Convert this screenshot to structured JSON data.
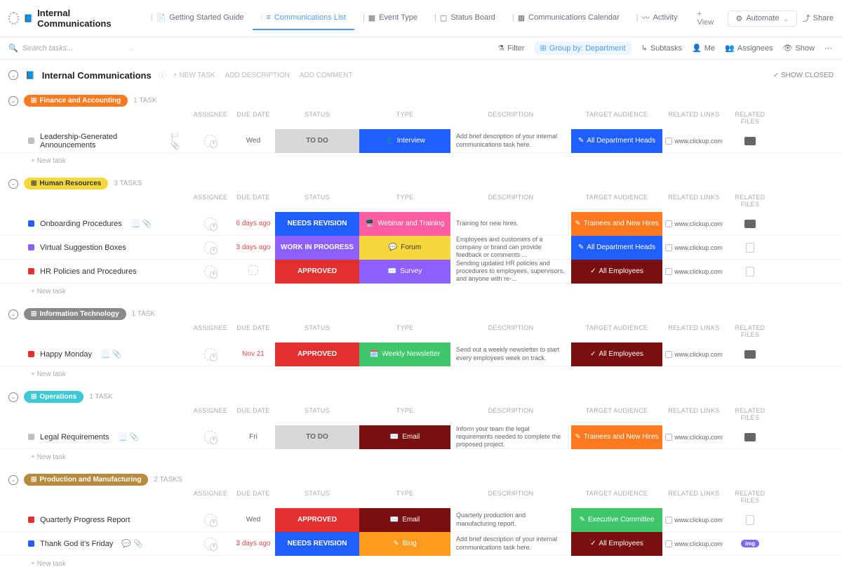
{
  "workspace": {
    "title": "Internal Communications"
  },
  "views": [
    {
      "label": "Getting Started Guide",
      "icon": "📄"
    },
    {
      "label": "Communications List",
      "icon": "≡",
      "active": true
    },
    {
      "label": "Event Type",
      "icon": "▦"
    },
    {
      "label": "Status Board",
      "icon": "▢"
    },
    {
      "label": "Communications Calendar",
      "icon": "▦"
    },
    {
      "label": "Activity",
      "icon": "〰"
    }
  ],
  "addView": "+ View",
  "topRight": {
    "automate": "Automate",
    "share": "Share"
  },
  "filterBar": {
    "searchPlaceholder": "Search tasks...",
    "filter": "Filter",
    "groupBy": "Group by: Department",
    "subtasks": "Subtasks",
    "me": "Me",
    "assignees": "Assignees",
    "show": "Show"
  },
  "listHeader": {
    "title": "Internal Communications",
    "newTask": "+ NEW TASK",
    "addDesc": "ADD DESCRIPTION",
    "addComment": "ADD COMMENT",
    "showClosed": "SHOW CLOSED"
  },
  "columns": {
    "assignee": "ASSIGNEE",
    "due": "DUE DATE",
    "status": "STATUS",
    "type": "TYPE",
    "desc": "DESCRIPTION",
    "audience": "TARGET AUDIENCE",
    "links": "RELATED LINKS",
    "files": "RELATED FILES"
  },
  "newTaskLabel": "+ New task",
  "link": "www.clickup.com",
  "groups": [
    {
      "name": "Finance and Accounting",
      "pillColor": "#fd7b1f",
      "count": "1 TASK",
      "tasks": [
        {
          "name": "Leadership-Generated Announcements",
          "dot": "#bfbfbf",
          "icons": "🏳️ 📎",
          "due": "Wed",
          "overdue": false,
          "status": "TO DO",
          "statusBg": "#d7d7d7",
          "statusColor": "#666",
          "type": "Interview",
          "typeIcon": "👤",
          "typeBg": "#1f5fff",
          "desc": "Add brief description of your internal communications task here.",
          "audience": "All Department Heads",
          "audIcon": "✎",
          "audBg": "#1f5fff",
          "file": "thumb"
        }
      ]
    },
    {
      "name": "Human Resources",
      "pillColor": "#f7d83c",
      "pillText": "#333",
      "count": "3 TASKS",
      "tasks": [
        {
          "name": "Onboarding Procedures",
          "dot": "#1f5fff",
          "icons": "📃 📎",
          "due": "6 days ago",
          "overdue": true,
          "status": "NEEDS REVISION",
          "statusBg": "#1f5fff",
          "type": "Webinar and Training",
          "typeIcon": "🖥️",
          "typeBg": "#ff5fa2",
          "desc": "Training for new hires.",
          "audience": "Trainees and New Hires",
          "audIcon": "✎",
          "audBg": "#ff7a1f",
          "file": "thumb"
        },
        {
          "name": "Virtual Suggestion Boxes",
          "dot": "#8c5fff",
          "icons": "",
          "due": "3 days ago",
          "overdue": true,
          "status": "WORK IN PROGRESS",
          "statusBg": "#8c5fff",
          "type": "Forum",
          "typeIcon": "💬",
          "typeBg": "#f7d83c",
          "typeColor": "#333",
          "desc": "Employees and customers of a company or brand can provide feedback or comments ...",
          "audience": "All Department Heads",
          "audIcon": "✎",
          "audBg": "#1f5fff",
          "file": "doc"
        },
        {
          "name": "HR Policies and Procedures",
          "dot": "#e52e2e",
          "icons": "",
          "due": "",
          "status": "APPROVED",
          "statusBg": "#e52e2e",
          "type": "Survey",
          "typeIcon": "✉️",
          "typeBg": "#8c5fff",
          "desc": "Sending updated HR policies and procedures to employees, supervisors, and anyone with re-...",
          "audience": "All Employees",
          "audIcon": "✓",
          "audBg": "#7a0f0f",
          "file": "doc"
        }
      ]
    },
    {
      "name": "Information Technology",
      "pillColor": "#8a8a8a",
      "count": "1 TASK",
      "tasks": [
        {
          "name": "Happy Monday",
          "dot": "#e52e2e",
          "icons": "📃 📎",
          "due": "Nov 21",
          "overdue": true,
          "status": "APPROVED",
          "statusBg": "#e52e2e",
          "type": "Weekly Newsletter",
          "typeIcon": "🗓️",
          "typeBg": "#3dc76a",
          "desc": "Send out a weekly newsletter to start every employees week on track.",
          "audience": "All Employees",
          "audIcon": "✓",
          "audBg": "#7a0f0f",
          "file": "thumb"
        }
      ]
    },
    {
      "name": "Operations",
      "pillColor": "#3cc9d6",
      "count": "1 TASK",
      "tasks": [
        {
          "name": "Legal Requirements",
          "dot": "#bfbfbf",
          "icons": "📃 📎",
          "due": "Fri",
          "overdue": false,
          "status": "TO DO",
          "statusBg": "#d7d7d7",
          "statusColor": "#666",
          "type": "Email",
          "typeIcon": "✉️",
          "typeBg": "#7a0f0f",
          "desc": "Inform your team the legal requirements needed to complete the proposed project.",
          "audience": "Trainees and New Hires",
          "audIcon": "✎",
          "audBg": "#ff7a1f",
          "file": "thumb"
        }
      ]
    },
    {
      "name": "Production and Manufacturing",
      "pillColor": "#b88a3c",
      "count": "2 TASKS",
      "tasks": [
        {
          "name": "Quarterly Progress Report",
          "dot": "#e52e2e",
          "icons": "",
          "due": "Wed",
          "overdue": false,
          "status": "APPROVED",
          "statusBg": "#e52e2e",
          "type": "Email",
          "typeIcon": "✉️",
          "typeBg": "#7a0f0f",
          "desc": "Quarterly production and manufacturing report.",
          "audience": "Executive Committee",
          "audIcon": "✎",
          "audBg": "#3dc76a",
          "file": "doc"
        },
        {
          "name": "Thank God it's Friday",
          "dot": "#1f5fff",
          "icons": "💬 📎",
          "due": "3 days ago",
          "overdue": true,
          "status": "NEEDS REVISION",
          "statusBg": "#1f5fff",
          "type": "Blog",
          "typeIcon": "✎",
          "typeBg": "#ff9a1f",
          "desc": "Add brief description of your internal communications task here.",
          "audience": "All Employees",
          "audIcon": "✓",
          "audBg": "#7a0f0f",
          "file": "chip"
        }
      ]
    }
  ]
}
